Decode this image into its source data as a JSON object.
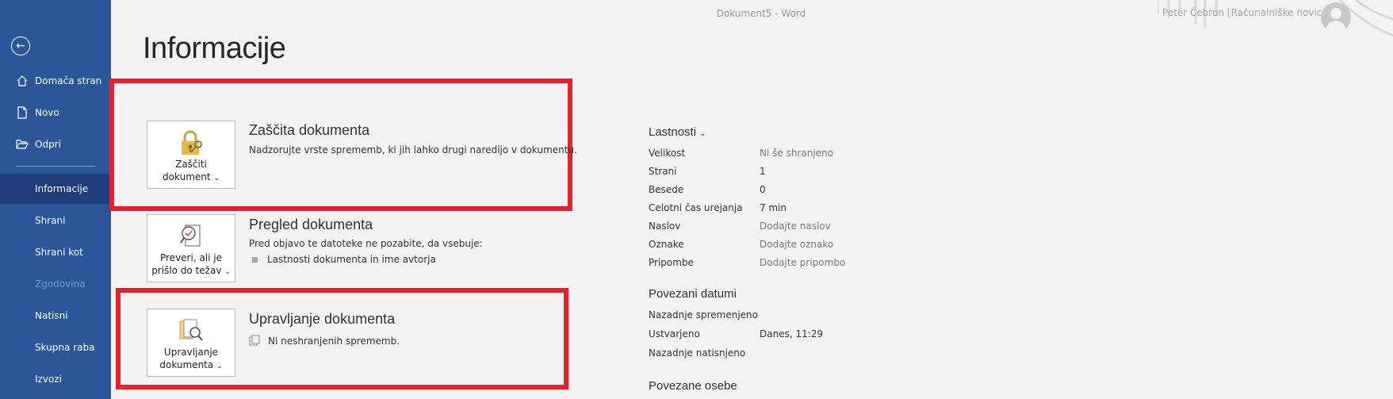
{
  "window": {
    "doc_title": "Dokument5  -  Word",
    "user_name": "Peter Čebron [Računalniške novice]"
  },
  "sidebar": {
    "back_icon": "back-arrow-icon",
    "items": [
      {
        "label": "Domača stran",
        "icon": "home-icon"
      },
      {
        "label": "Novo",
        "icon": "new-document-icon"
      },
      {
        "label": "Odpri",
        "icon": "open-folder-icon"
      },
      {
        "label": "Informacije",
        "active": true
      },
      {
        "label": "Shrani"
      },
      {
        "label": "Shrani kot"
      },
      {
        "label": "Zgodovina",
        "disabled": true
      },
      {
        "label": "Natisni"
      },
      {
        "label": "Skupna raba"
      },
      {
        "label": "Izvozi"
      }
    ]
  },
  "page": {
    "title": "Informacije"
  },
  "sections": {
    "protect": {
      "button_line1": "Zaščiti",
      "button_line2": "dokument",
      "title": "Zaščita dokumenta",
      "desc": "Nadzorujte vrste sprememb, ki jih lahko drugi naredijo v dokumentu.",
      "icon": "lock-key-icon"
    },
    "inspect": {
      "button_line1": "Preveri, ali je",
      "button_line2": "prišlo do težav",
      "title": "Pregled dokumenta",
      "desc": "Pred objavo te datoteke ne pozabite, da vsebuje:",
      "bullet": "Lastnosti dokumenta in ime avtorja",
      "icon": "inspect-document-icon"
    },
    "manage": {
      "button_line1": "Upravljanje",
      "button_line2": "dokumenta",
      "title": "Upravljanje dokumenta",
      "desc": "Ni neshranjenih sprememb.",
      "icon": "manage-document-icon"
    }
  },
  "properties": {
    "heading": "Lastnosti",
    "rows": [
      {
        "key": "Velikost",
        "value": "Ni še shranjeno"
      },
      {
        "key": "Strani",
        "value": "1"
      },
      {
        "key": "Besede",
        "value": "0"
      },
      {
        "key": "Celotni čas urejanja",
        "value": "7 min"
      },
      {
        "key": "Naslov",
        "value": "Dodajte naslov"
      },
      {
        "key": "Oznake",
        "value": "Dodajte oznako"
      },
      {
        "key": "Pripombe",
        "value": "Dodajte pripombo"
      }
    ]
  },
  "related_dates": {
    "heading": "Povezani datumi",
    "rows": [
      {
        "key": "Nazadnje spremenjeno",
        "value": ""
      },
      {
        "key": "Ustvarjeno",
        "value": "Danes, 11:29"
      },
      {
        "key": "Nazadnje natisnjeno",
        "value": ""
      }
    ]
  },
  "related_people": {
    "heading": "Povezane osebe"
  },
  "colors": {
    "sidebar": "#2b579a",
    "sidebar_active": "#1f3d7a",
    "highlight": "#e8202a"
  }
}
